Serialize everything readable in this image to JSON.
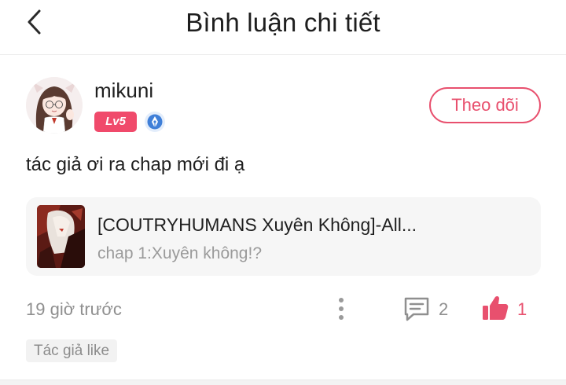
{
  "header": {
    "title": "Bình luận chi tiết",
    "back_icon": "chevron-left-icon"
  },
  "comment": {
    "user": {
      "name": "mikuni",
      "level": "Lv5",
      "badge_icon": "quill-pen-badge-icon",
      "avatar": "anime-girl-avatar"
    },
    "follow_label": "Theo dõi",
    "text": "tác giả ơi ra chap mới đi ạ",
    "story": {
      "title": "[COUTRYHUMANS Xuyên Không]-All...",
      "chapter": "chap 1:Xuyên không!?"
    },
    "time": "19 giờ trước",
    "reply_count": "2",
    "like_count": "1",
    "author_like_tag": "Tác giả like"
  },
  "colors": {
    "accent": "#e8506e",
    "level_badge": "#f04a6b",
    "muted_text": "#8f8f8f",
    "card_bg": "#f6f6f6"
  }
}
